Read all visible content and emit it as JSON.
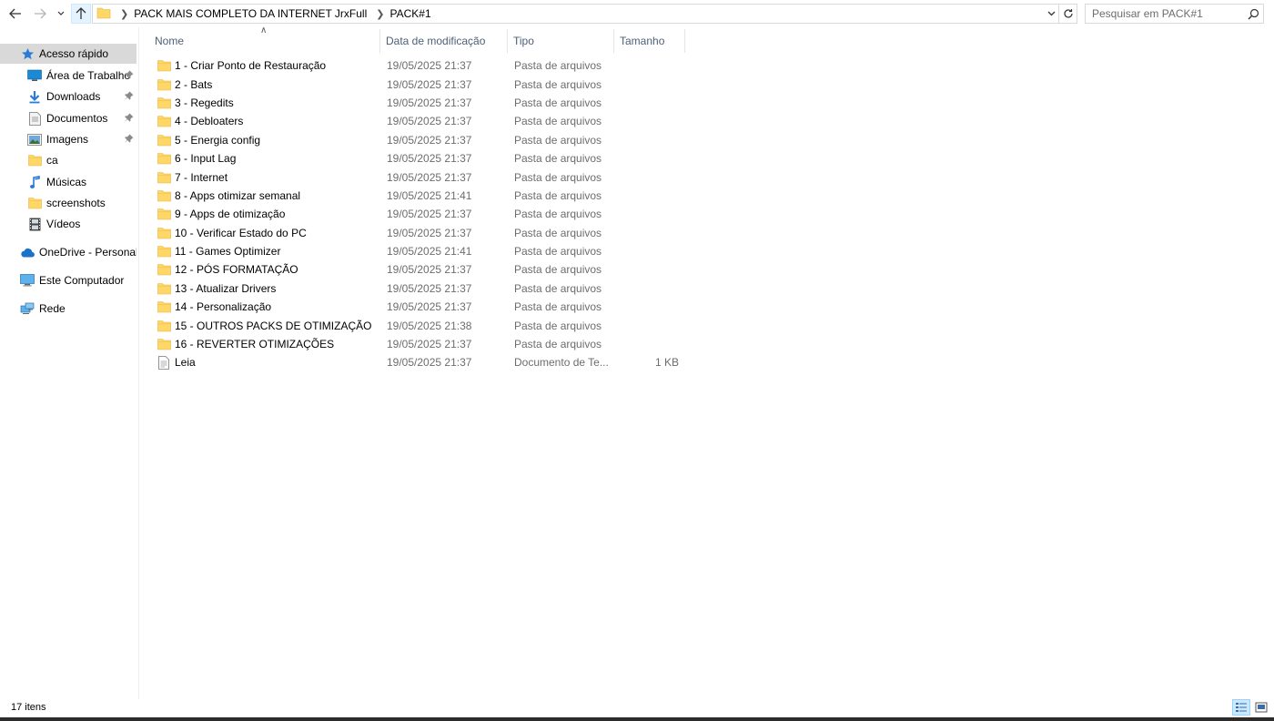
{
  "navigation": {
    "breadcrumbs": [
      "PACK MAIS COMPLETO DA INTERNET JrxFull",
      "PACK#1"
    ],
    "search_placeholder": "Pesquisar em PACK#1"
  },
  "sidebar": {
    "items": [
      {
        "label": "Acesso rápido",
        "icon": "star-icon",
        "pinned": false,
        "selected": true
      },
      {
        "label": "Área de Trabalho",
        "icon": "desktop-icon",
        "pinned": true
      },
      {
        "label": "Downloads",
        "icon": "download-arrow-icon",
        "pinned": true
      },
      {
        "label": "Documentos",
        "icon": "document-icon",
        "pinned": true
      },
      {
        "label": "Imagens",
        "icon": "pictures-icon",
        "pinned": true
      },
      {
        "label": "ca",
        "icon": "folder-icon",
        "pinned": false
      },
      {
        "label": "Músicas",
        "icon": "music-note-icon",
        "pinned": false
      },
      {
        "label": "screenshots",
        "icon": "folder-icon",
        "pinned": false
      },
      {
        "label": "Vídeos",
        "icon": "film-icon",
        "pinned": false
      },
      {
        "label": "OneDrive - Personal",
        "icon": "cloud-icon",
        "pinned": false
      },
      {
        "label": "Este Computador",
        "icon": "computer-icon",
        "pinned": false
      },
      {
        "label": "Rede",
        "icon": "network-icon",
        "pinned": false
      }
    ]
  },
  "columns": {
    "name": "Nome",
    "date": "Data de modificação",
    "type": "Tipo",
    "size": "Tamanho"
  },
  "files": [
    {
      "name": "1 - Criar Ponto de Restauração",
      "date": "19/05/2025 21:37",
      "type": "Pasta de arquivos",
      "size": "",
      "icon": "folder-icon"
    },
    {
      "name": "2 - Bats",
      "date": "19/05/2025 21:37",
      "type": "Pasta de arquivos",
      "size": "",
      "icon": "folder-icon"
    },
    {
      "name": "3 - Regedits",
      "date": "19/05/2025 21:37",
      "type": "Pasta de arquivos",
      "size": "",
      "icon": "folder-icon"
    },
    {
      "name": "4 - Debloaters",
      "date": "19/05/2025 21:37",
      "type": "Pasta de arquivos",
      "size": "",
      "icon": "folder-icon"
    },
    {
      "name": "5 - Energia config",
      "date": "19/05/2025 21:37",
      "type": "Pasta de arquivos",
      "size": "",
      "icon": "folder-icon"
    },
    {
      "name": "6 - Input Lag",
      "date": "19/05/2025 21:37",
      "type": "Pasta de arquivos",
      "size": "",
      "icon": "folder-icon"
    },
    {
      "name": "7 - Internet",
      "date": "19/05/2025 21:37",
      "type": "Pasta de arquivos",
      "size": "",
      "icon": "folder-icon"
    },
    {
      "name": "8 - Apps otimizar semanal",
      "date": "19/05/2025 21:41",
      "type": "Pasta de arquivos",
      "size": "",
      "icon": "folder-icon"
    },
    {
      "name": "9 - Apps de otimização",
      "date": "19/05/2025 21:37",
      "type": "Pasta de arquivos",
      "size": "",
      "icon": "folder-icon"
    },
    {
      "name": "10 - Verificar Estado do PC",
      "date": "19/05/2025 21:37",
      "type": "Pasta de arquivos",
      "size": "",
      "icon": "folder-icon"
    },
    {
      "name": "11 - Games Optimizer",
      "date": "19/05/2025 21:41",
      "type": "Pasta de arquivos",
      "size": "",
      "icon": "folder-icon"
    },
    {
      "name": "12 - PÓS FORMATAÇÃO",
      "date": "19/05/2025 21:37",
      "type": "Pasta de arquivos",
      "size": "",
      "icon": "folder-icon"
    },
    {
      "name": "13 - Atualizar Drivers",
      "date": "19/05/2025 21:37",
      "type": "Pasta de arquivos",
      "size": "",
      "icon": "folder-icon"
    },
    {
      "name": "14 - Personalização",
      "date": "19/05/2025 21:37",
      "type": "Pasta de arquivos",
      "size": "",
      "icon": "folder-icon"
    },
    {
      "name": "15 - OUTROS PACKS DE OTIMIZAÇÃO",
      "date": "19/05/2025 21:38",
      "type": "Pasta de arquivos",
      "size": "",
      "icon": "folder-icon"
    },
    {
      "name": "16 - REVERTER OTIMIZAÇÕES",
      "date": "19/05/2025 21:37",
      "type": "Pasta de arquivos",
      "size": "",
      "icon": "folder-icon"
    },
    {
      "name": "Leia",
      "date": "19/05/2025 21:37",
      "type": "Documento de Te...",
      "size": "1 KB",
      "icon": "text-file-icon"
    }
  ],
  "status": {
    "item_count": "17 itens"
  },
  "colors": {
    "folder": "#ffd766",
    "selected_nav": "#d9d9d9",
    "header_text": "#4c607a",
    "secondary_text": "#6d6d6d"
  }
}
